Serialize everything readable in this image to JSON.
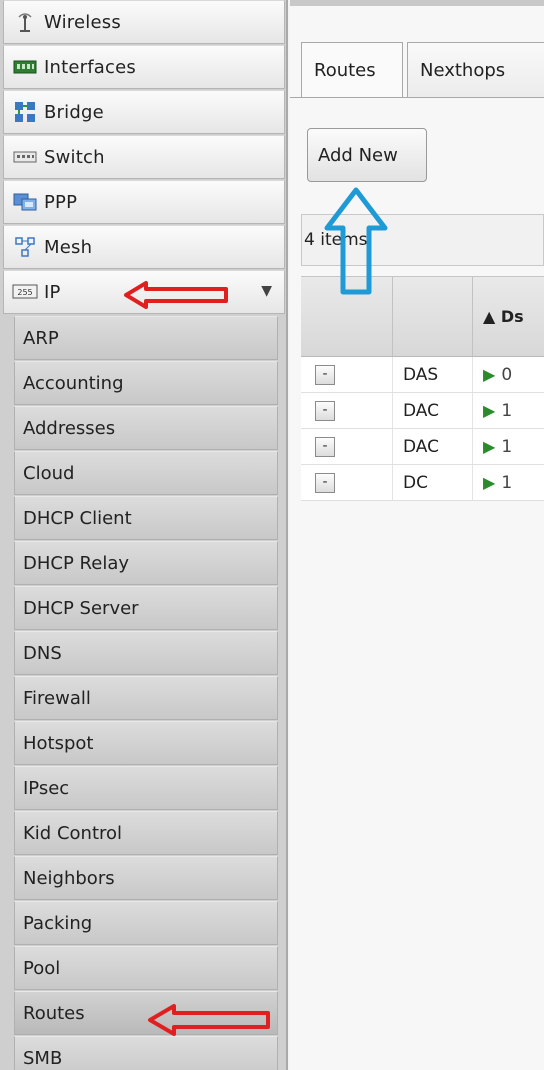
{
  "sidebar": {
    "top_items": [
      {
        "label": "Wireless",
        "icon": "antenna-icon"
      },
      {
        "label": "Interfaces",
        "icon": "network-card-icon"
      },
      {
        "label": "Bridge",
        "icon": "bridge-icon"
      },
      {
        "label": "Switch",
        "icon": "switch-icon"
      },
      {
        "label": "PPP",
        "icon": "ppp-icon"
      },
      {
        "label": "Mesh",
        "icon": "mesh-icon"
      },
      {
        "label": "IP",
        "icon": "ip-icon",
        "badge": "255",
        "expanded": true
      }
    ],
    "ip_submenu": [
      "ARP",
      "Accounting",
      "Addresses",
      "Cloud",
      "DHCP Client",
      "DHCP Relay",
      "DHCP Server",
      "DNS",
      "Firewall",
      "Hotspot",
      "IPsec",
      "Kid Control",
      "Neighbors",
      "Packing",
      "Pool",
      "Routes",
      "SMB"
    ],
    "active_submenu": "Routes"
  },
  "main": {
    "tabs": [
      "Routes",
      "Nexthops"
    ],
    "active_tab": "Routes",
    "add_button": "Add New",
    "items_count": "4 items",
    "grid": {
      "headers": [
        "",
        "",
        "▲ Ds"
      ],
      "rows": [
        {
          "button": "-",
          "flags": "DAS",
          "dst": "0"
        },
        {
          "button": "-",
          "flags": "DAC",
          "dst": "1"
        },
        {
          "button": "-",
          "flags": "DAC",
          "dst": "1"
        },
        {
          "button": "-",
          "flags": "DC",
          "dst": "1"
        }
      ]
    }
  },
  "annotations": {
    "red_arrow_color": "#e02020",
    "blue_arrow_color": "#1e9ad6"
  }
}
